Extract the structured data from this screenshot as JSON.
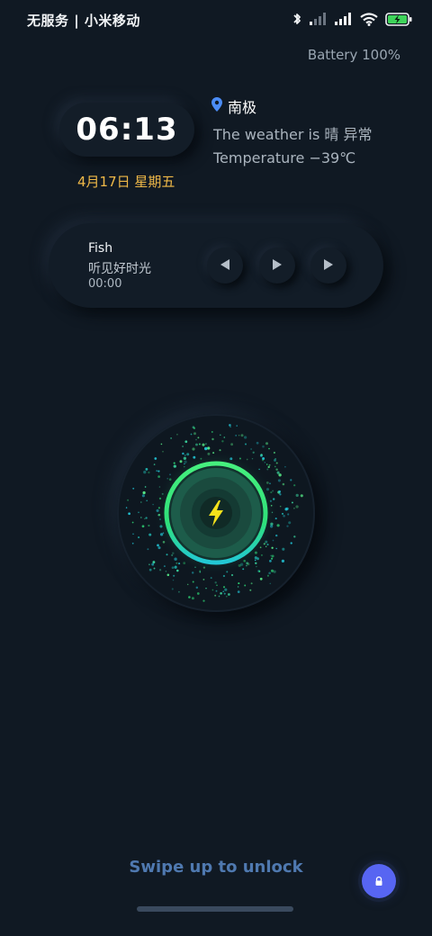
{
  "status_bar": {
    "carrier": "无服务 | 小米移动",
    "icons": [
      "bluetooth-icon",
      "signal-weak-icon",
      "signal-full-icon",
      "wifi-icon",
      "battery-charging-icon"
    ],
    "battery_level": 1.0
  },
  "battery_label": "Battery 100%",
  "clock": {
    "time": "06:13",
    "date": "4月17日 星期五"
  },
  "location": {
    "icon": "location-pin-icon",
    "name": "南极"
  },
  "weather": {
    "condition_line": "The weather is 晴 异常",
    "temperature_line": "Temperature −39℃"
  },
  "music": {
    "title": "Fish",
    "artist": "听见好时光",
    "time": "00:00",
    "controls": [
      "previous-icon",
      "play-icon",
      "next-icon"
    ]
  },
  "charging": {
    "icon": "lightning-bolt-icon",
    "colors": {
      "ring": "#33e07a",
      "accent": "#22c7d8",
      "bolt": "#f5e21b"
    }
  },
  "unlock": {
    "label": "Swipe up to unlock",
    "button_icon": "lock-icon"
  },
  "colors": {
    "background": "#101923",
    "date_text": "#f0b948",
    "swipe_text": "#4f79b0",
    "corner_button": "#5765f2"
  }
}
